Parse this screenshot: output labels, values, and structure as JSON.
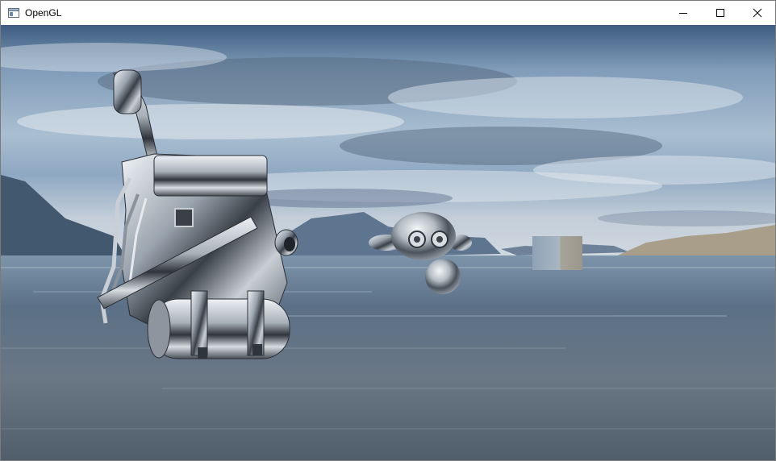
{
  "window": {
    "title": "OpenGL",
    "app_icon": "window-app-icon",
    "controls": [
      {
        "name": "minimize",
        "icon": "minimize-icon"
      },
      {
        "name": "maximize",
        "icon": "maximize-icon"
      },
      {
        "name": "close",
        "icon": "close-icon"
      }
    ]
  },
  "scene": {
    "description_icons": [
      "skybox-sky",
      "mountains",
      "ocean",
      "metallic-robot-model",
      "monkey-head-model",
      "reflective-cube"
    ],
    "colors": {
      "sky_top": "#2f4f72",
      "sky_mid": "#9bb4cc",
      "horizon": "#c9d3dc",
      "water_far": "#5f7a92",
      "water_near": "#6a7480",
      "mountain": "#4c627a",
      "sand": "#a99d88",
      "chrome_light": "#e4e8ec",
      "chrome_dark": "#2a2f36"
    }
  }
}
